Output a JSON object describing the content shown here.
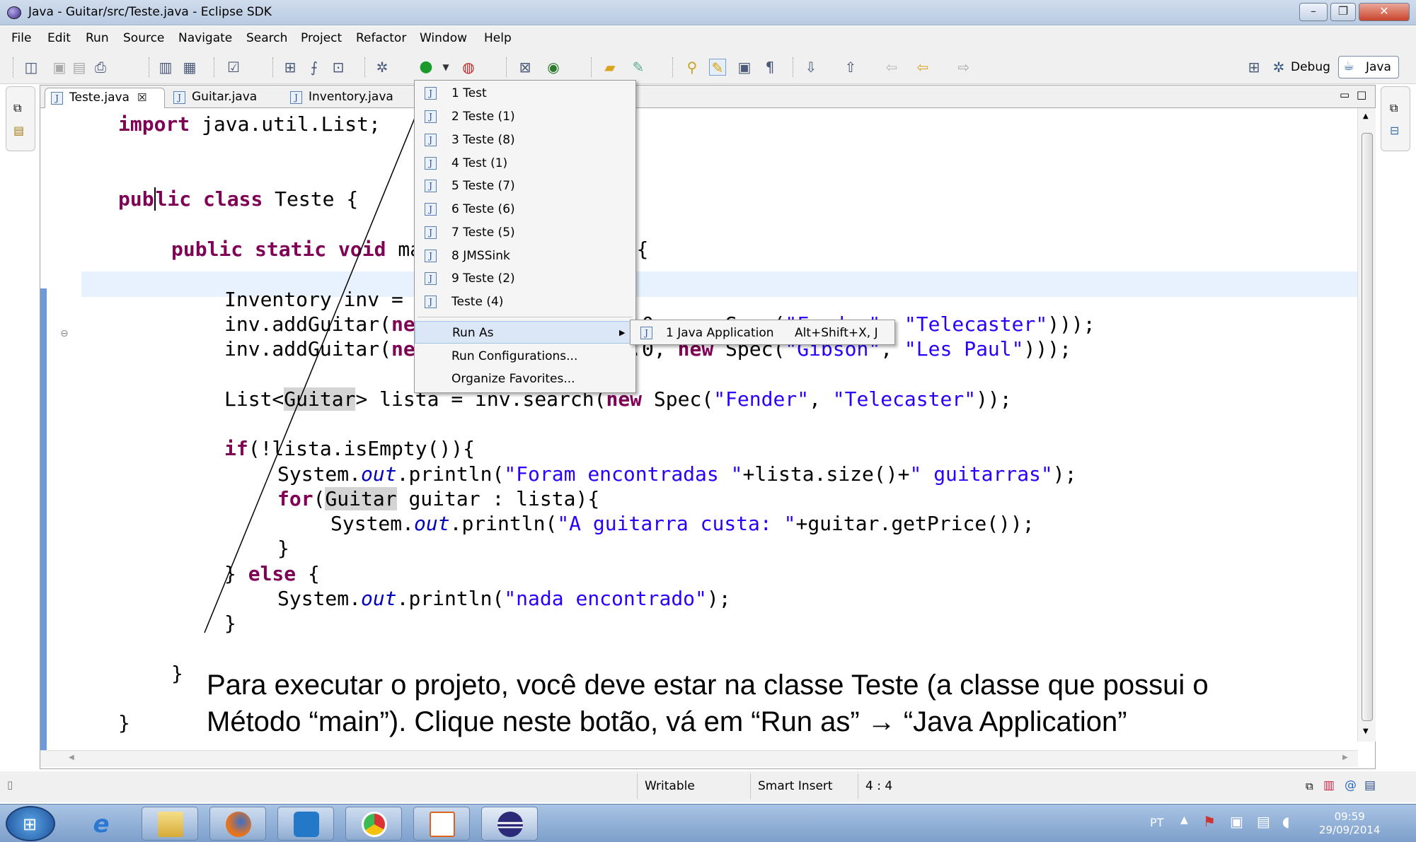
{
  "window": {
    "title": "Java - Guitar/src/Teste.java - Eclipse SDK"
  },
  "menubar": [
    "File",
    "Edit",
    "Run",
    "Source",
    "Navigate",
    "Search",
    "Project",
    "Refactor",
    "Window",
    "Help"
  ],
  "perspectives": {
    "debug": "Debug",
    "java": "Java"
  },
  "tabs": [
    {
      "label": "Teste.java",
      "close": "☒"
    },
    {
      "label": "Guitar.java"
    },
    {
      "label": "Inventory.java"
    }
  ],
  "code_lines": [
    "import java.util.List;",
    "public class Teste {",
    "public static void main(String[] args) {",
    "Inventory inv = new Inventory();",
    "inv.addGuitar(new Guitar(\"1\", 3000.0, new Spec(\"Fender\", \"Telecaster\")));",
    "inv.addGuitar(new Guitar(\"2\", 5600.0, new Spec(\"Gibson\", \"Les Paul\")));",
    "List<Guitar> lista = inv.search(new Spec(\"Fender\", \"Telecaster\"));",
    "if(!lista.isEmpty()){",
    "System.out.println(\"Foram encontradas \"+lista.size()+\" guitarras\");",
    "for(Guitar guitar : lista){",
    "System.out.println(\"A guitarra custa: \"+guitar.getPrice());",
    "}",
    "} else {",
    "System.out.println(\"nada encontrado\");",
    "}",
    "}",
    "}"
  ],
  "run_menu": {
    "history": [
      "1 Test",
      "2 Teste (1)",
      "3 Teste (8)",
      "4 Test (1)",
      "5 Teste (7)",
      "6 Teste (6)",
      "7 Teste (5)",
      "8 JMSSink",
      "9 Teste (2)",
      "Teste (4)"
    ],
    "run_as": "Run As",
    "run_configurations": "Run Configurations...",
    "organize_favorites": "Organize Favorites...",
    "submenu": {
      "label": "1 Java Application",
      "shortcut": "Alt+Shift+X, J"
    }
  },
  "status": {
    "writable": "Writable",
    "insert_mode": "Smart Insert",
    "position": "4 : 4"
  },
  "annotation": "Para executar o projeto, você deve estar na classe Teste (a classe que possui o\nMétodo “main”). Clique neste botão, vá em “Run as” → “Java Application”",
  "tray": {
    "language": "PT",
    "time": "09:59",
    "date": "29/09/2014"
  },
  "colors": {
    "keyword": "#7f0055",
    "string": "#2a00ff",
    "static_field": "#0000c0",
    "current_line": "#e8f2fe"
  }
}
